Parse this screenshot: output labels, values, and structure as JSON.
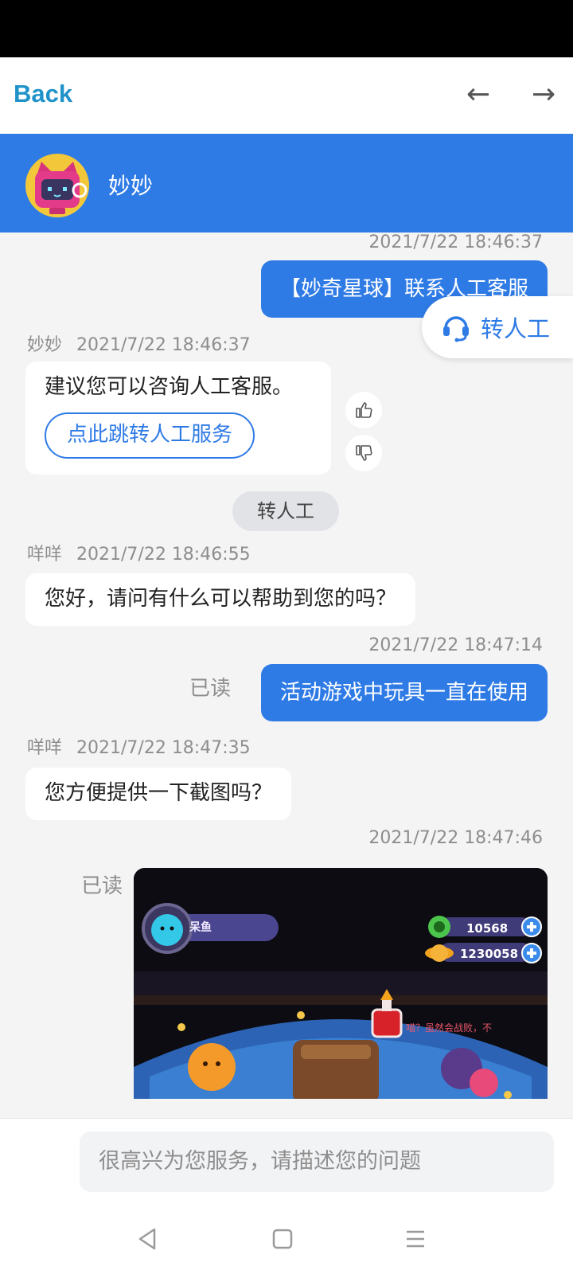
{
  "top_nav": {
    "back_label": "Back",
    "prev_arrow": "←",
    "next_arrow": "→"
  },
  "header": {
    "name": "妙妙"
  },
  "floating": {
    "transfer_label": "转人工",
    "icon": "headset-icon"
  },
  "messages": {
    "m1": {
      "time": "2021/7/22 18:46:37",
      "text": "【妙奇星球】联系人工客服"
    },
    "m2": {
      "sender": "妙妙",
      "time": "2021/7/22 18:46:37",
      "text": "建议您可以咨询人工客服。",
      "button": "点此跳转人工服务"
    },
    "chip": "转人工",
    "m3": {
      "sender": "咩咩",
      "time": "2021/7/22 18:46:55",
      "text": "您好，请问有什么可以帮助到您的吗？"
    },
    "m4": {
      "time": "2021/7/22 18:47:14",
      "text": "活动游戏中玩具一直在使用",
      "read": "已读"
    },
    "m5": {
      "sender": "咩咩",
      "time": "2021/7/22 18:47:35",
      "text": "您方便提供一下截图吗？"
    },
    "m6": {
      "time": "2021/7/22 18:47:46",
      "read": "已读",
      "screenshot": {
        "player_name": "呆鱼",
        "stat1": "10568",
        "stat2": "1230058",
        "dialog": "喵？虽然会战败，不"
      }
    }
  },
  "input": {
    "placeholder": "很高兴为您服务，请描述您的问题"
  },
  "colors": {
    "accent": "#2f7be6",
    "back_link": "#1f93c9",
    "bg": "#f4f4f5"
  }
}
